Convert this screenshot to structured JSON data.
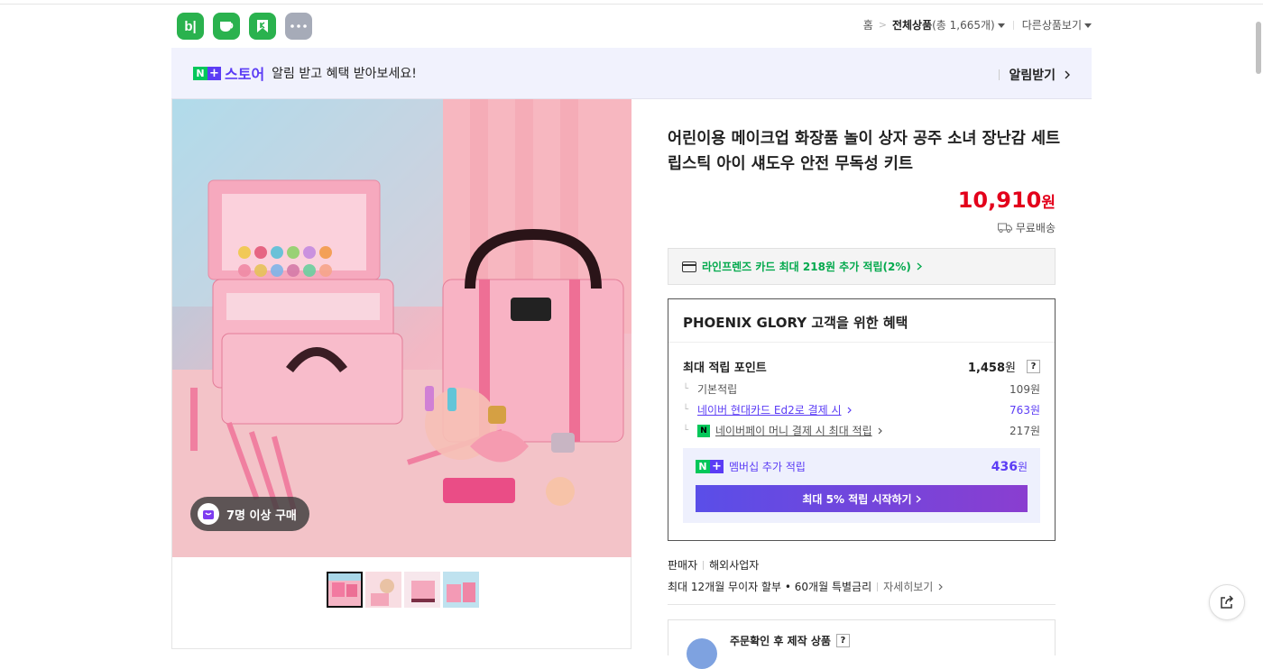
{
  "header": {
    "apps": [
      {
        "name": "blog",
        "glyph": "b|"
      },
      {
        "name": "cafe"
      },
      {
        "name": "kreme"
      },
      {
        "name": "more"
      }
    ],
    "breadcrumb": {
      "home": "홈",
      "all_prefix": "전체상품",
      "all_count": "(총 1,665개)",
      "other": "다른상품보기"
    }
  },
  "banner": {
    "badge_n": "N",
    "badge_plus": "+",
    "store": "스토어",
    "text": "알림 받고 혜택 받아보세요!",
    "action": "알림받기"
  },
  "gallery": {
    "buy_badge": "7명 이상 구매",
    "thumbnail_count": 4,
    "selected_thumbnail": 1
  },
  "product": {
    "title": "어린이용 메이크업 화장품 놀이 상자 공주 소녀 장난감 세트 립스틱 아이 섀도우 안전 무독성 키트",
    "price": "10,910",
    "currency": "원",
    "shipping": "무료배송",
    "card_promo": "라인프렌즈 카드 최대 218원 추가 적립(2%)"
  },
  "benefits": {
    "title": "PHOENIX GLORY 고객을 위한 혜택",
    "max_point_label": "최대 적립 포인트",
    "max_point_value": "1,458",
    "max_point_unit": "원",
    "basic_label": "기본적립",
    "basic_value": "109원",
    "hyundai_label": "네이버 현대카드 Ed2로 결제 시",
    "hyundai_value": "763원",
    "npay_label": "네이버페이 머니 결제 시 최대 적립",
    "npay_value": "217원",
    "membership_label": "멤버십 추가 적립",
    "membership_value": "436",
    "membership_unit": "원",
    "membership_button": "최대 5% 적립 시작하기"
  },
  "seller": {
    "label": "판매자",
    "value": "해외사업자"
  },
  "installment": {
    "text": "최대 12개월 무이자 할부 • 60개월 특별금리",
    "more": "자세히보기"
  },
  "bottom_box": {
    "text": "주문확인 후 제작 상품"
  },
  "colors": {
    "accent_green": "#03c75a",
    "naver_plus_purple": "#5b3cf5",
    "price_red": "#e3001b"
  }
}
